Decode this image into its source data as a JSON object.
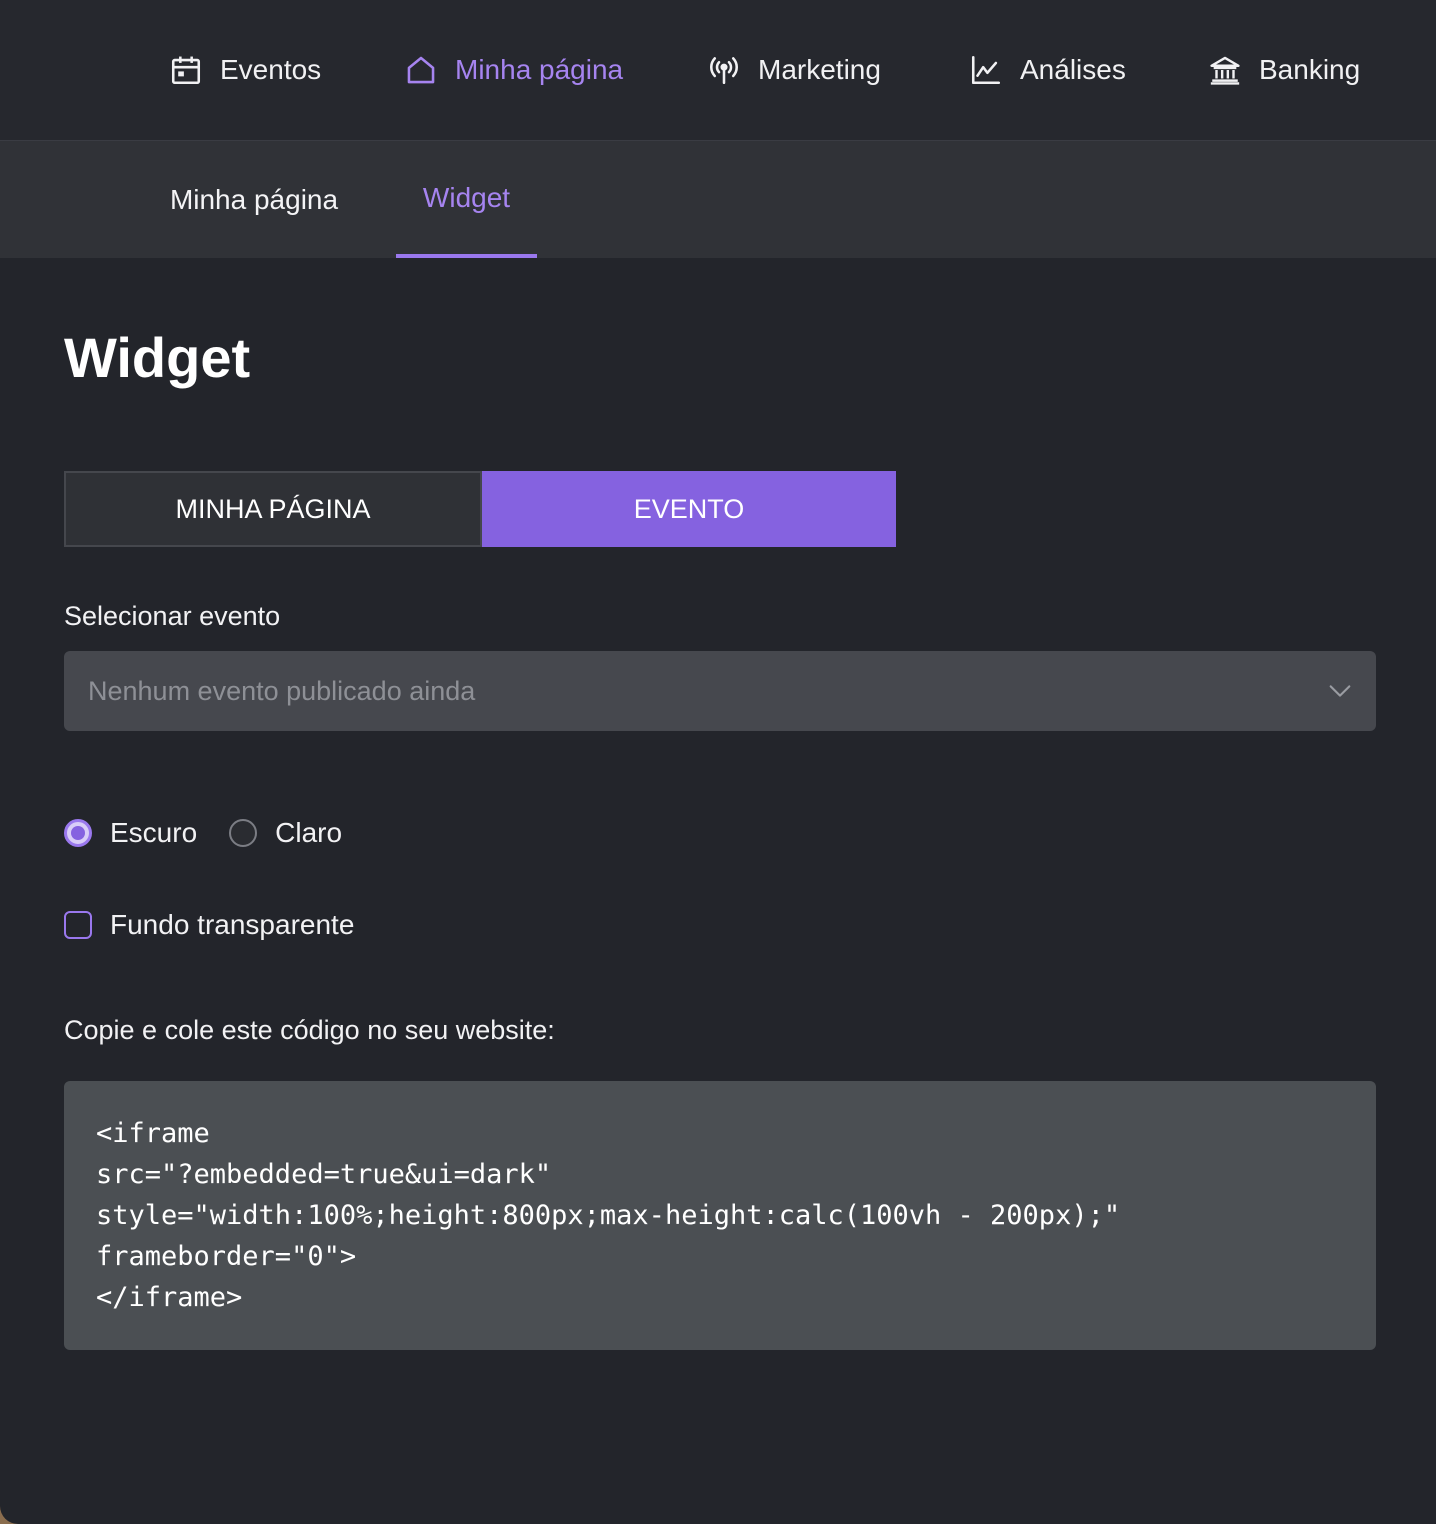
{
  "topnav": {
    "items": [
      {
        "label": "Eventos",
        "icon": "calendar-icon"
      },
      {
        "label": "Minha página",
        "icon": "home-icon",
        "active": true
      },
      {
        "label": "Marketing",
        "icon": "broadcast-icon"
      },
      {
        "label": "Análises",
        "icon": "line-chart-icon"
      },
      {
        "label": "Banking",
        "icon": "bank-icon"
      }
    ]
  },
  "subnav": {
    "tabs": [
      {
        "label": "Minha página"
      },
      {
        "label": "Widget",
        "active": true
      }
    ]
  },
  "main": {
    "title": "Widget",
    "segments": [
      {
        "label": "MINHA PÁGINA"
      },
      {
        "label": "EVENTO",
        "selected": true
      }
    ],
    "select_label": "Selecionar evento",
    "select_placeholder": "Nenhum evento publicado ainda",
    "theme_options": [
      {
        "label": "Escuro",
        "checked": true
      },
      {
        "label": "Claro",
        "checked": false
      }
    ],
    "transparent_label": "Fundo transparente",
    "transparent_checked": false,
    "code_label": "Copie e cole este código no seu website:",
    "code_lines": [
      "<iframe",
      "src=\"?embedded=true&ui=dark\"",
      "style=\"width:100%;height:800px;max-height:calc(100vh - 200px);\"",
      "frameborder=\"0\">",
      "</iframe>"
    ]
  },
  "colors": {
    "accent": "#8562e0",
    "accent_text": "#a684f0",
    "background": "#23252b"
  }
}
